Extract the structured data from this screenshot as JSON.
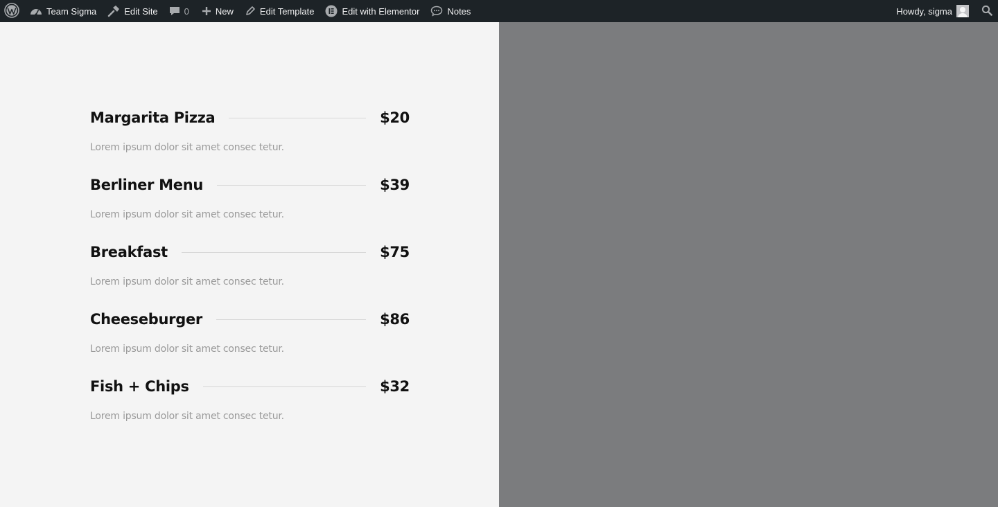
{
  "adminbar": {
    "site_name": "Team Sigma",
    "edit_site": "Edit Site",
    "comments_count": "0",
    "new_label": "New",
    "edit_template": "Edit Template",
    "edit_elementor": "Edit with Elementor",
    "notes": "Notes",
    "howdy": "Howdy, sigma"
  },
  "menu": {
    "items": [
      {
        "title": "Margarita Pizza",
        "price": "$20",
        "description": "Lorem ipsum dolor sit amet consec tetur."
      },
      {
        "title": "Berliner Menu",
        "price": "$39",
        "description": "Lorem ipsum dolor sit amet consec tetur."
      },
      {
        "title": "Breakfast",
        "price": "$75",
        "description": "Lorem ipsum dolor sit amet consec tetur."
      },
      {
        "title": "Cheeseburger",
        "price": "$86",
        "description": "Lorem ipsum dolor sit amet consec tetur."
      },
      {
        "title": "Fish + Chips",
        "price": "$32",
        "description": "Lorem ipsum dolor sit amet consec tetur."
      }
    ]
  },
  "colors": {
    "adminbar_bg": "#1d2327",
    "left_bg": "#f4f4f4",
    "right_bg": "#7b7c7e",
    "title_text": "#111111",
    "desc_text": "#9a9a9a"
  }
}
